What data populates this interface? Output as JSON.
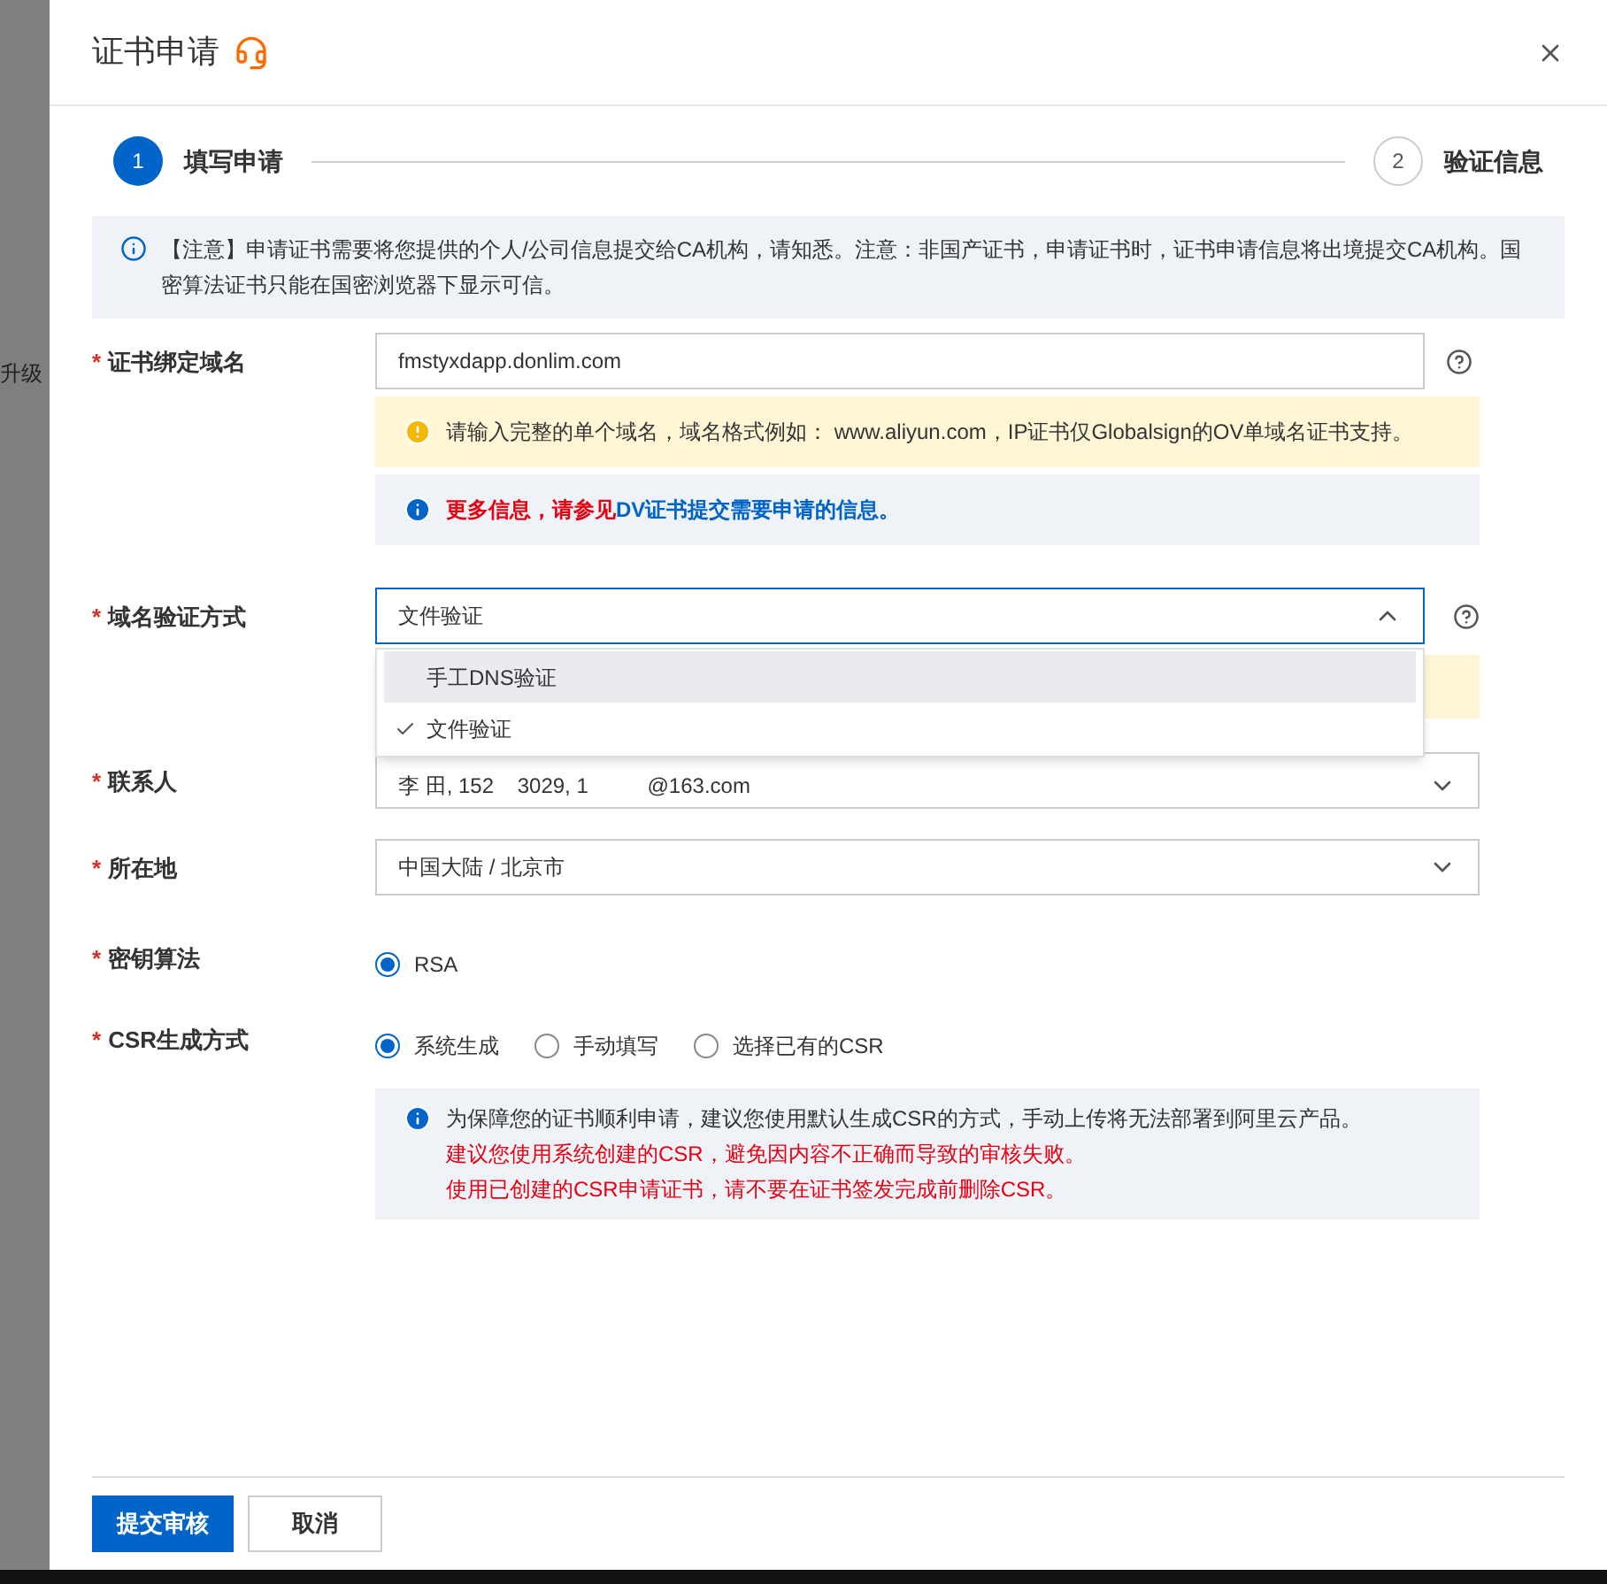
{
  "backdrop": {
    "text": "升级"
  },
  "dialog": {
    "title": "证书申请"
  },
  "steps": [
    {
      "number": "1",
      "label": "填写申请",
      "selected": true
    },
    {
      "number": "2",
      "label": "验证信息",
      "selected": false
    }
  ],
  "notice": "【注意】申请证书需要将您提供的个人/公司信息提交给CA机构，请知悉。注意：非国产证书，申请证书时，证书申请信息将出境提交CA机构。国密算法证书只能在国密浏览器下显示可信。",
  "domain": {
    "marker": "*",
    "label": "证书绑定域名",
    "value": "fmstyxdapp.donlim.com",
    "warning": "请输入完整的单个域名，域名格式例如： www.aliyun.com，IP证书仅Globalsign的OV单域名证书支持。",
    "info_prefix": "更多信息，请参见",
    "info_link": "DV证书提交需要申请的信息。"
  },
  "verification": {
    "marker": "*",
    "label": "域名验证方式",
    "value": "文件验证",
    "expanded": true,
    "options": [
      {
        "label": "手工DNS验证",
        "selected": false,
        "hovered": true
      },
      {
        "label": "文件验证",
        "selected": true,
        "hovered": false
      }
    ]
  },
  "contact": {
    "marker": "*",
    "label": "联系人",
    "value": "李 田, 152    3029, 1          @163.com"
  },
  "location": {
    "marker": "*",
    "label": "所在地",
    "value": "中国大陆 / 北京市"
  },
  "key_algorithm": {
    "marker": "*",
    "label": "密钥算法",
    "options": [
      {
        "label": "RSA",
        "selected": true
      }
    ]
  },
  "csr": {
    "marker": "*",
    "label": "CSR生成方式",
    "options": [
      {
        "label": "系统生成",
        "selected": true
      },
      {
        "label": "手动填写",
        "selected": false
      },
      {
        "label": "选择已有的CSR",
        "selected": false
      }
    ],
    "tips": [
      {
        "text": "为保障您的证书顺利申请，建议您使用默认生成CSR的方式，手动上传将无法部署到阿里云产品。",
        "kind": "normal"
      },
      {
        "text": "建议您使用系统创建的CSR，避免因内容不正确而导致的审核失败。",
        "kind": "warning"
      },
      {
        "text": "使用已创建的CSR申请证书，请不要在证书签发完成前删除CSR。",
        "kind": "warning"
      }
    ]
  },
  "buttons": [
    {
      "label": "提交审核",
      "kind": "primary"
    },
    {
      "label": "取消",
      "kind": "default"
    }
  ]
}
